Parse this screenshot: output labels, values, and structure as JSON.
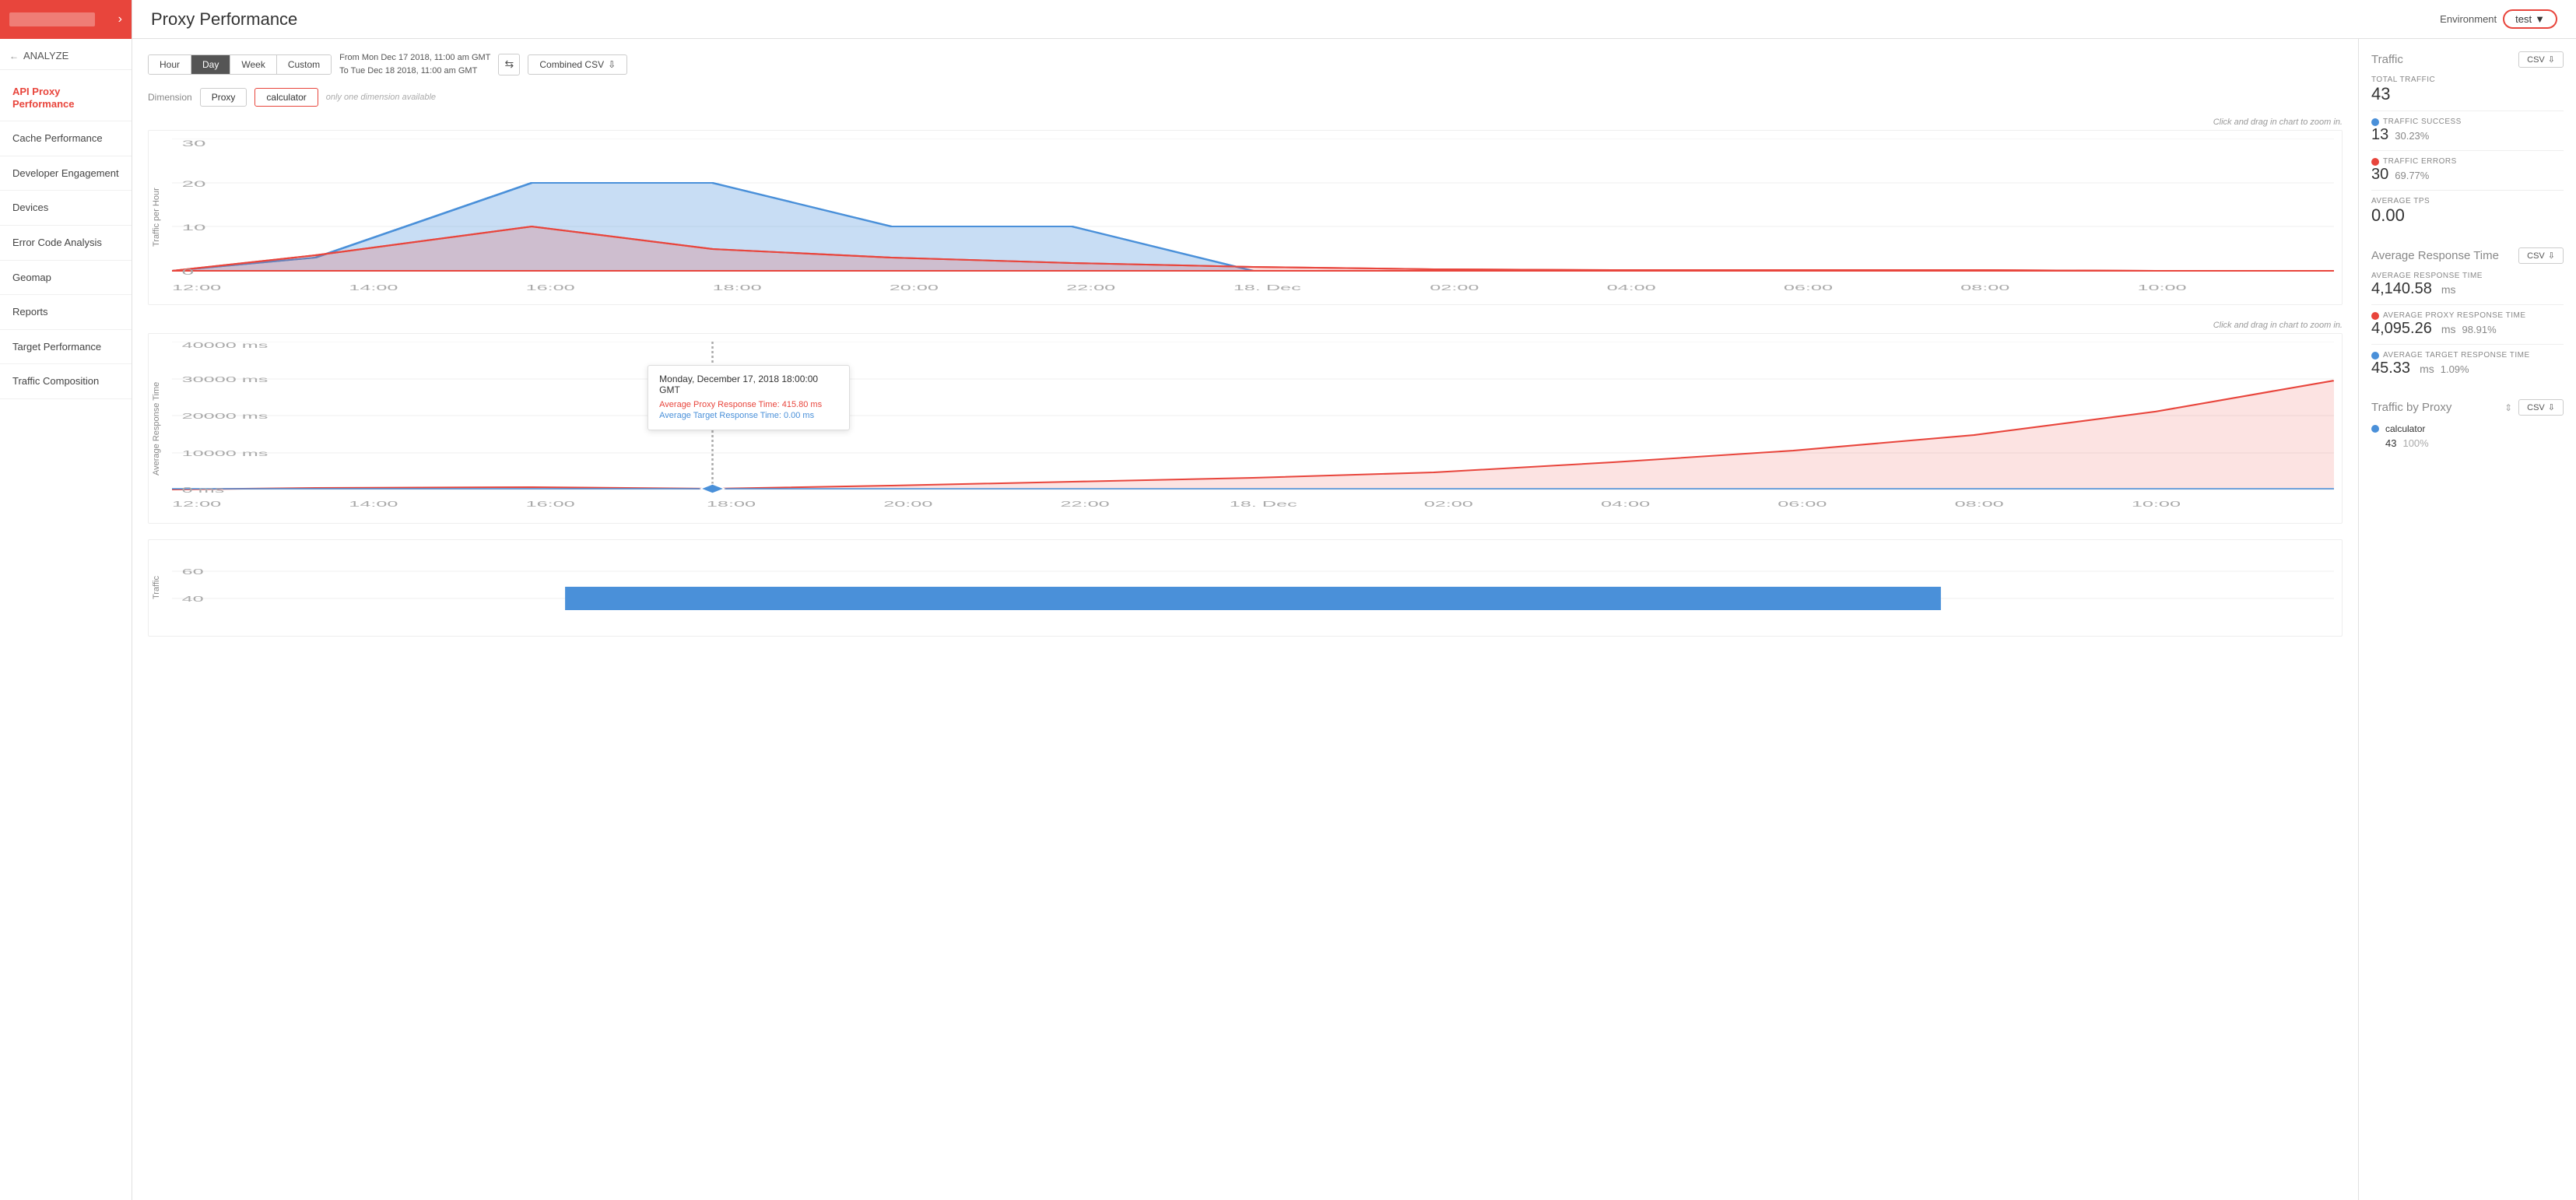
{
  "sidebar": {
    "logo_alt": "Logo",
    "analyze_label": "ANALYZE",
    "items": [
      {
        "id": "api-proxy-performance",
        "label": "API Proxy Performance",
        "active": true
      },
      {
        "id": "cache-performance",
        "label": "Cache Performance",
        "active": false
      },
      {
        "id": "developer-engagement",
        "label": "Developer Engagement",
        "active": false
      },
      {
        "id": "devices",
        "label": "Devices",
        "active": false
      },
      {
        "id": "error-code-analysis",
        "label": "Error Code Analysis",
        "active": false
      },
      {
        "id": "geomap",
        "label": "Geomap",
        "active": false
      },
      {
        "id": "reports",
        "label": "Reports",
        "active": false
      },
      {
        "id": "target-performance",
        "label": "Target Performance",
        "active": false
      },
      {
        "id": "traffic-composition",
        "label": "Traffic Composition",
        "active": false
      }
    ]
  },
  "topbar": {
    "title": "Proxy Performance",
    "env_label": "Environment",
    "env_value": "test"
  },
  "filter": {
    "time_buttons": [
      {
        "label": "Hour",
        "active": false
      },
      {
        "label": "Day",
        "active": true
      },
      {
        "label": "Week",
        "active": false
      },
      {
        "label": "Custom",
        "active": false
      }
    ],
    "date_from": "From Mon Dec 17 2018, 11:00 am GMT",
    "date_to": "To   Tue Dec 18 2018, 11:00 am GMT",
    "combined_csv": "Combined CSV"
  },
  "dimension": {
    "label": "Dimension",
    "proxy_tag": "Proxy",
    "calculator_tag": "calculator",
    "only_label": "only one dimension available"
  },
  "chart1": {
    "zoom_hint": "Click and drag in chart to zoom in.",
    "y_label": "Traffic per Hour",
    "x_ticks": [
      "12:00",
      "14:00",
      "16:00",
      "18:00",
      "20:00",
      "22:00",
      "18. Dec",
      "02:00",
      "04:00",
      "06:00",
      "08:00",
      "10:00"
    ],
    "y_ticks": [
      "0",
      "10",
      "20",
      "30"
    ]
  },
  "chart2": {
    "zoom_hint": "Click and drag in chart to zoom in.",
    "y_label": "Average Response Time",
    "x_ticks": [
      "12:00",
      "14:00",
      "16:00",
      "18:00",
      "20:00",
      "22:00",
      "18. Dec",
      "02:00",
      "04:00",
      "06:00",
      "08:00",
      "10:00"
    ],
    "y_ticks": [
      "0 ms",
      "10000 ms",
      "20000 ms",
      "30000 ms",
      "40000 ms"
    ],
    "tooltip": {
      "date": "Monday, December 17, 2018 18:00:00 GMT",
      "proxy_label": "Average Proxy Response Time:",
      "proxy_value": "415.80 ms",
      "target_label": "Average Target Response Time:",
      "target_value": "0.00 ms"
    }
  },
  "chart3": {
    "y_ticks": [
      "40",
      "60"
    ],
    "y_label": "Traffic"
  },
  "traffic_stats": {
    "title": "Traffic",
    "csv_label": "CSV",
    "total_label": "TOTAL TRAFFIC",
    "total_value": "43",
    "success_label": "TRAFFIC SUCCESS",
    "success_value": "13",
    "success_pct": "30.23%",
    "errors_label": "TRAFFIC ERRORS",
    "errors_value": "30",
    "errors_pct": "69.77%",
    "tps_label": "AVERAGE TPS",
    "tps_value": "0.00"
  },
  "response_stats": {
    "title": "Average Response Time",
    "csv_label": "CSV",
    "avg_label": "AVERAGE RESPONSE TIME",
    "avg_value": "4,140.58",
    "avg_unit": "ms",
    "proxy_label": "AVERAGE PROXY RESPONSE TIME",
    "proxy_value": "4,095.26",
    "proxy_unit": "ms",
    "proxy_pct": "98.91%",
    "target_label": "AVERAGE TARGET RESPONSE TIME",
    "target_value": "45.33",
    "target_unit": "ms",
    "target_pct": "1.09%"
  },
  "proxy_stats": {
    "title": "Traffic by Proxy",
    "csv_label": "CSV",
    "items": [
      {
        "name": "calculator",
        "count": "43",
        "pct": "100%"
      }
    ]
  },
  "colors": {
    "red": "#e8453c",
    "blue": "#4a90d9",
    "light_red": "rgba(232,69,60,0.15)",
    "light_blue": "rgba(74,144,217,0.25)"
  }
}
